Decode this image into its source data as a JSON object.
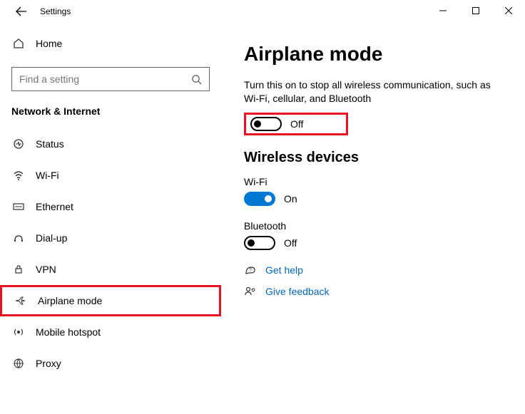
{
  "window": {
    "title": "Settings"
  },
  "sidebar": {
    "home_label": "Home",
    "search_placeholder": "Find a setting",
    "category": "Network & Internet",
    "items": [
      {
        "label": "Status"
      },
      {
        "label": "Wi-Fi"
      },
      {
        "label": "Ethernet"
      },
      {
        "label": "Dial-up"
      },
      {
        "label": "VPN"
      },
      {
        "label": "Airplane mode"
      },
      {
        "label": "Mobile hotspot"
      },
      {
        "label": "Proxy"
      }
    ]
  },
  "main": {
    "heading": "Airplane mode",
    "description": "Turn this on to stop all wireless communication, such as Wi-Fi, cellular, and Bluetooth",
    "airplane_toggle_label": "Off",
    "wireless_heading": "Wireless devices",
    "wifi": {
      "label": "Wi-Fi",
      "toggle_label": "On"
    },
    "bluetooth": {
      "label": "Bluetooth",
      "toggle_label": "Off"
    },
    "help_label": "Get help",
    "feedback_label": "Give feedback"
  }
}
